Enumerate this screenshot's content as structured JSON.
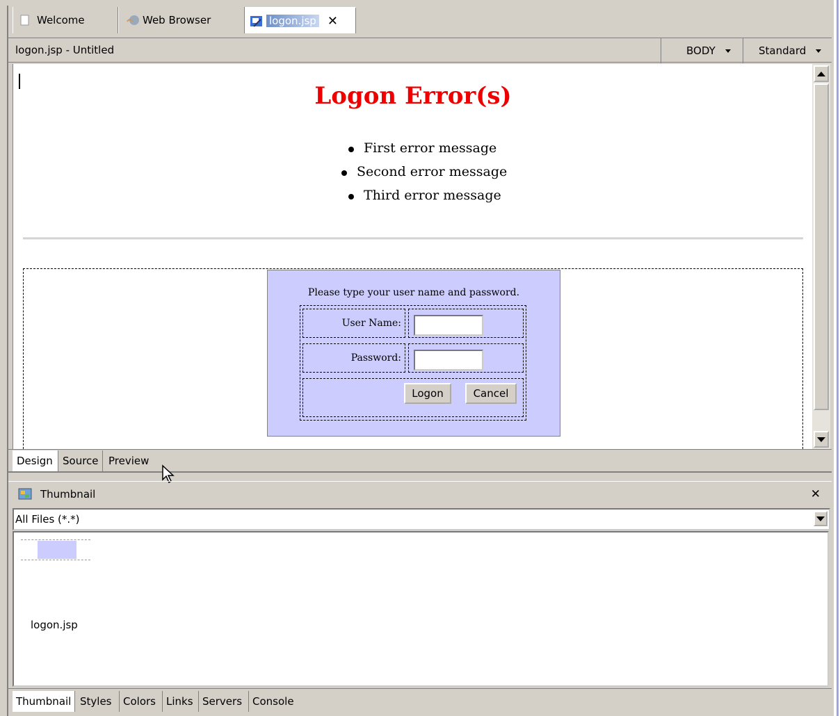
{
  "editor_tabs": [
    {
      "label": "Welcome",
      "icon": "page-icon"
    },
    {
      "label": "Web Browser",
      "icon": "globe-hand-icon"
    },
    {
      "label": "logon.jsp",
      "icon": "jsp-file-icon"
    }
  ],
  "close_glyph": "✕",
  "document_title": "logon.jsp - Untitled",
  "tag_selector": "BODY",
  "view_mode": "Standard",
  "page": {
    "heading": "Logon Error(s)",
    "errors": [
      "First error message",
      "Second error message",
      "Third error message"
    ],
    "prompt": "Please type your user name and password.",
    "username_label": "User Name:",
    "password_label": "Password:",
    "username_value": "",
    "password_value": "",
    "logon_button": "Logon",
    "cancel_button": "Cancel",
    "panel_color": "#ccccff",
    "heading_color": "#ee0000"
  },
  "editor_mode_tabs": [
    "Design",
    "Source",
    "Preview"
  ],
  "thumbnail": {
    "title": "Thumbnail",
    "filter": "All Files (*.*)",
    "file_name": "logon.jsp"
  },
  "bottom_tabs": [
    "Thumbnail",
    "Styles",
    "Colors",
    "Links",
    "Servers",
    "Console"
  ]
}
